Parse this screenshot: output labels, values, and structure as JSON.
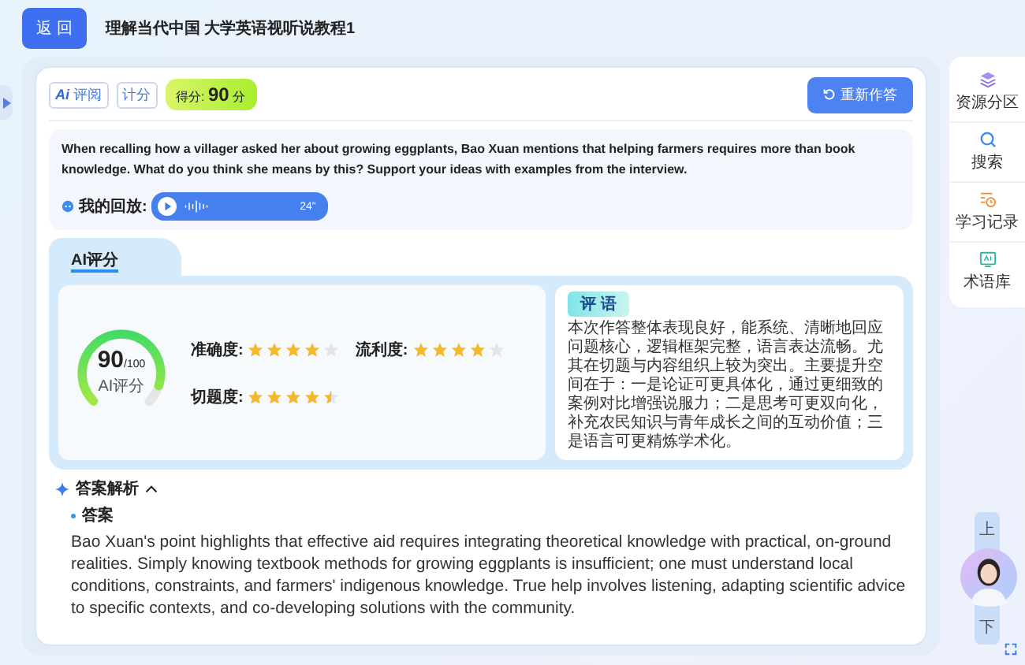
{
  "header": {
    "back_button": "返 回",
    "title": "理解当代中国 大学英语视听说教程1"
  },
  "toolbar": {
    "tags": [
      {
        "kind": "ai",
        "mark": "Ai",
        "label": "评阅"
      },
      {
        "kind": "plain",
        "label": "计分"
      }
    ],
    "score_label": "得分:",
    "score_value": "90",
    "score_unit": "分",
    "retry_button": "重新作答"
  },
  "question": {
    "text": "When recalling how a villager asked her about growing eggplants, Bao Xuan mentions that helping farmers requires more than book knowledge. What do you think she means by this? Support your ideas with examples from the interview.",
    "playback_label": "我的回放:",
    "audio_duration": "24\""
  },
  "ai_score": {
    "title": "AI评分",
    "score": "90",
    "total": "/100",
    "gauge_label": "AI评分",
    "level": 0.9,
    "criteria": [
      {
        "label": "准确度:",
        "stars": 4
      },
      {
        "label": "流利度:",
        "stars": 4
      },
      {
        "label": "切题度:",
        "stars": 4.5
      }
    ],
    "comment_title": "评 语",
    "comment": "本次作答整体表现良好，能系统、清晰地回应问题核心，逻辑框架完整，语言表达流畅。尤其在切题与内容组织上较为突出。主要提升空间在于：一是论证可更具体化，通过更细致的案例对比增强说服力；二是思考可更双向化，补充农民知识与青年成长之间的互动价值；三是语言可更精炼学术化。"
  },
  "analysis": {
    "title": "答案解析",
    "expanded": true,
    "answer_label": "答案",
    "answer": "Bao Xuan's point highlights that effective aid requires integrating theoretical knowledge with practical, on-ground realities. Simply knowing textbook methods for growing eggplants is insufficient; one must understand local conditions, constraints, and farmers' indigenous knowledge. True help involves listening, adapting scientific advice to specific contexts, and co-developing solutions with the community."
  },
  "sidebar": {
    "items": [
      {
        "kind": "layers",
        "label": "资源分区"
      },
      {
        "kind": "search",
        "label": "搜索"
      },
      {
        "kind": "history",
        "label": "学习记录"
      },
      {
        "kind": "terms",
        "label": "术语库"
      }
    ]
  },
  "nav_tab": {
    "prev": "上",
    "next": "下"
  }
}
